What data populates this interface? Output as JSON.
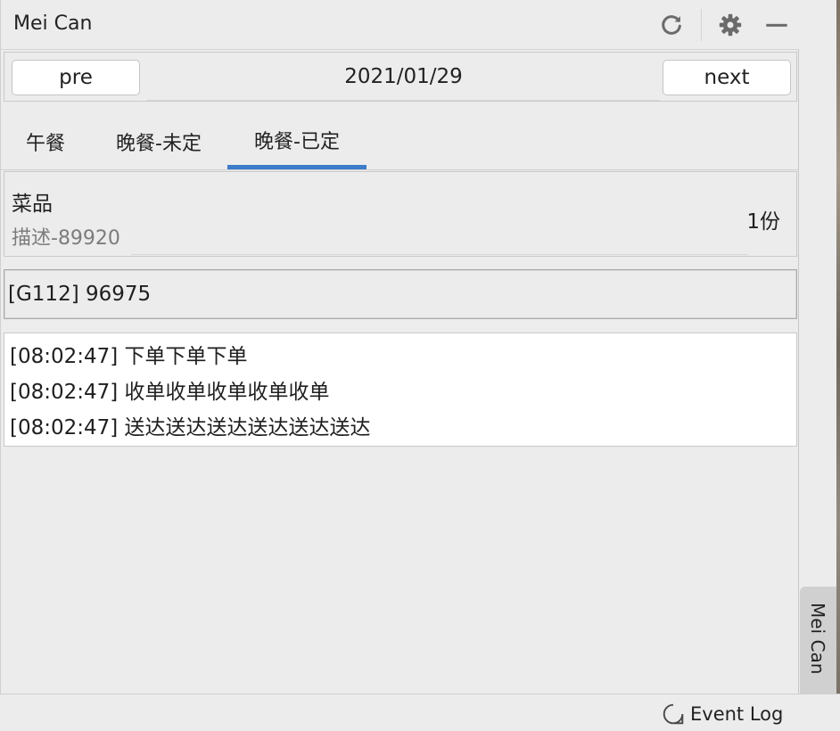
{
  "window": {
    "title": "Mei Can"
  },
  "toolbar": {
    "icons": [
      "refresh-icon",
      "gear-icon",
      "minimize-icon"
    ]
  },
  "date_nav": {
    "prev_label": "pre",
    "date": "2021/01/29",
    "next_label": "next"
  },
  "tabs": [
    {
      "label": "午餐",
      "active": false
    },
    {
      "label": "晚餐-未定",
      "active": false
    },
    {
      "label": "晚餐-已定",
      "active": true
    }
  ],
  "accent_color": "#3d7ccb",
  "dish": {
    "name": "菜品",
    "description": "描述-89920",
    "quantity": "1份"
  },
  "order": {
    "line": "[G112] 96975"
  },
  "log": [
    "[08:02:47] 下单下单下单",
    "[08:02:47] 收单收单收单收单收单",
    "[08:02:47] 送达送达送达送达送达送达"
  ],
  "status_bar": {
    "event_log": "Event Log"
  },
  "side_tab": {
    "label": "Mei Can"
  }
}
